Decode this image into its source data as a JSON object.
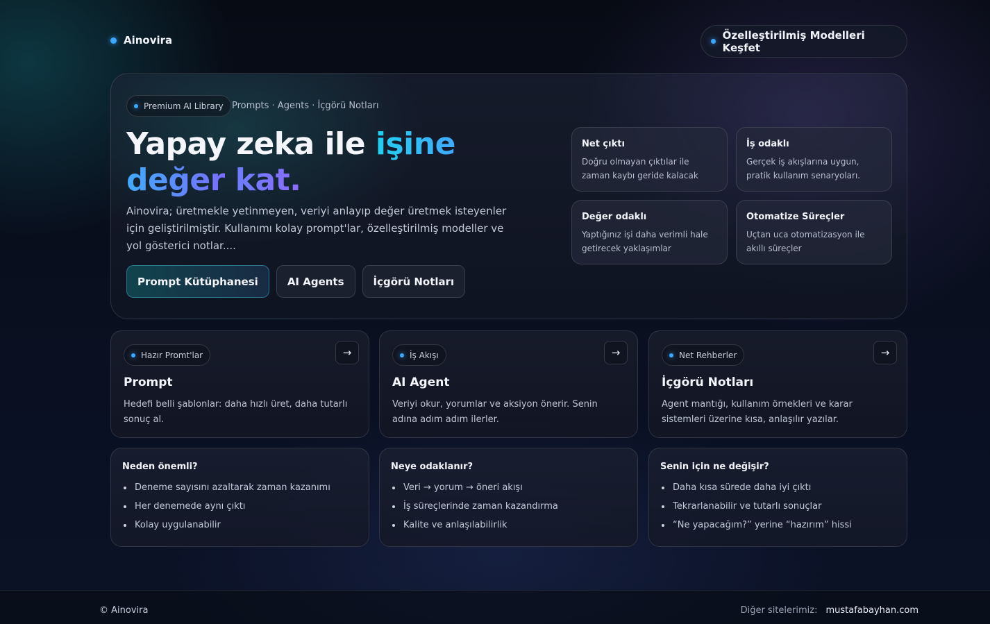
{
  "header": {
    "brand": "Ainovira",
    "explore_label": "Özelleştirilmiş Modelleri Keşfet"
  },
  "hero": {
    "badge": "Premium AI Library",
    "crumbs": "Prompts · Agents · İçgörü Notları",
    "title_part1": "Yapay zeka ile ",
    "title_highlight": "işine değer",
    "title_part2": "kat.",
    "description": "Ainovira; üretmekle yetinmeyen, veriyi anlayıp değer üretmek isteyenler için geliştirilmiştir. Kullanımı kolay prompt'lar, özelleştirilmiş modeller ve yol gösterici notlar....",
    "buttons": {
      "prompt_library": "Prompt Kütüphanesi",
      "ai_agents": "AI Agents",
      "insight_notes": "İçgörü Notları"
    },
    "features": [
      {
        "title": "Net çıktı",
        "text": "Doğru olmayan çıktılar ile zaman kaybı geride kalacak"
      },
      {
        "title": "İş odaklı",
        "text": "Gerçek iş akışlarına uygun, pratik kullanım senaryoları."
      },
      {
        "title": "Değer odaklı",
        "text": "Yaptığınız işi daha verimli hale getirecek yaklaşımlar"
      },
      {
        "title": "Otomatize Süreçler",
        "text": "Uçtan uca otomatizasyon ile akıllı süreçler"
      }
    ]
  },
  "cards": [
    {
      "badge": "Hazır Promt'lar",
      "title": "Prompt",
      "text": "Hedefi belli şablonlar: daha hızlı üret, daha tutarlı sonuç al.",
      "arrow": "→"
    },
    {
      "badge": "İş Akışı",
      "title": "AI Agent",
      "text": "Veriyi okur, yorumlar ve aksiyon önerir. Senin adına adım adım ilerler.",
      "arrow": "→"
    },
    {
      "badge": "Net Rehberler",
      "title": "İçgörü Notları",
      "text": "Agent mantığı, kullanım örnekleri ve karar sistemleri üzerine kısa, anlaşılır yazılar.",
      "arrow": "→"
    }
  ],
  "info": [
    {
      "title": "Neden önemli?",
      "items": [
        "Deneme sayısını azaltarak zaman kazanımı",
        "Her denemede aynı çıktı",
        "Kolay uygulanabilir"
      ]
    },
    {
      "title": "Neye odaklanır?",
      "items": [
        "Veri → yorum → öneri akışı",
        "İş süreçlerinde zaman kazandırma",
        "Kalite ve anlaşılabilirlik"
      ]
    },
    {
      "title": "Senin için ne değişir?",
      "items": [
        "Daha kısa sürede daha iyi çıktı",
        "Tekrarlanabilir ve tutarlı sonuçlar",
        "“Ne yapacağım?” yerine “hazırım” hissi"
      ]
    }
  ],
  "footer": {
    "copyright": "© Ainovira",
    "other_label": "Diğer sitelerimiz:",
    "other_link": "mustafabayhan.com"
  },
  "colors": {
    "accent": "#3aa8ff",
    "gradient_start": "#1fd0f0",
    "gradient_end": "#7a6cff"
  }
}
